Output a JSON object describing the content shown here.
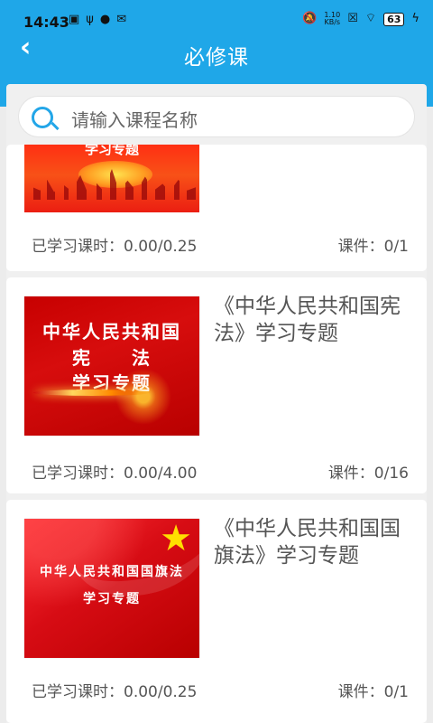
{
  "status": {
    "time": "14:43",
    "network_speed_value": "1.10",
    "network_speed_unit": "KB/s",
    "battery": "63"
  },
  "nav": {
    "title": "必修课"
  },
  "search": {
    "placeholder": "请输入课程名称"
  },
  "courses": [
    {
      "thumbnail_text": "学习专题",
      "hours": "已学习课时：0.00/0.25",
      "courseware": "课件：0/1"
    },
    {
      "thumbnail_line1": "中华人民共和国",
      "thumbnail_line2": "宪　　法",
      "thumbnail_line3": "学习专题",
      "title": "《中华人民共和国宪法》学习专题",
      "hours": "已学习课时：0.00/4.00",
      "courseware": "课件：0/16"
    },
    {
      "thumbnail_line1": "中华人民共和国国旗法",
      "thumbnail_line2": "学习专题",
      "title": "《中华人民共和国国旗法》学习专题",
      "hours": "已学习课时：0.00/0.25",
      "courseware": "课件：0/1"
    }
  ],
  "icons": {
    "back": "chevron-left-icon",
    "search": "search-icon",
    "star": "star-icon"
  },
  "colors": {
    "header": "#1fa7e8",
    "accent": "#23a6e8"
  }
}
